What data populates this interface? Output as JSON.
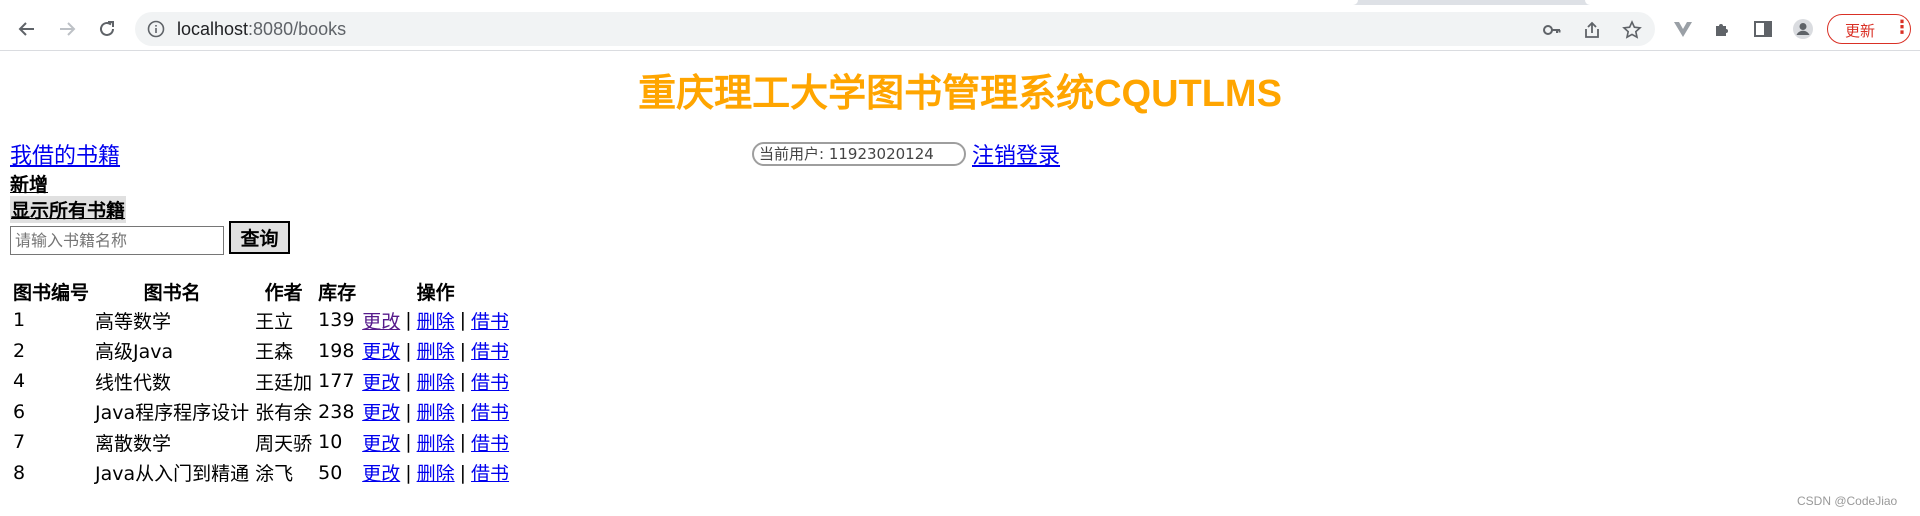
{
  "browser": {
    "url_host": "localhost",
    "url_rest": ":8080/books",
    "update_label": "更新",
    "menu_glyph": "⋮"
  },
  "page": {
    "title": "重庆理工大学图书管理系统CQUTLMS",
    "my_books_link": "我借的书籍",
    "current_user": "当前用户: 11923020124",
    "logout_link": "注销登录",
    "add_link": "新增",
    "show_all_button": "显示所有书籍",
    "search_placeholder": "请输入书籍名称",
    "query_button": "查询"
  },
  "table": {
    "headers": [
      "图书编号",
      "图书名",
      "作者",
      "库存",
      "操作"
    ],
    "actions": {
      "edit": "更改",
      "delete": "删除",
      "borrow": "借书",
      "separator": "|"
    },
    "rows": [
      {
        "id": "1",
        "name": "高等数学",
        "author": "王立",
        "stock": "139"
      },
      {
        "id": "2",
        "name": "高级Java",
        "author": "王森",
        "stock": "198"
      },
      {
        "id": "4",
        "name": "线性代数",
        "author": "王廷加",
        "stock": "177"
      },
      {
        "id": "6",
        "name": "Java程序程序设计",
        "author": "张有余",
        "stock": "238"
      },
      {
        "id": "7",
        "name": "离散数学",
        "author": "周天骄",
        "stock": "10"
      },
      {
        "id": "8",
        "name": "Java从入门到精通",
        "author": "涂飞",
        "stock": "50"
      }
    ]
  },
  "watermark": "CSDN @CodeJiao"
}
